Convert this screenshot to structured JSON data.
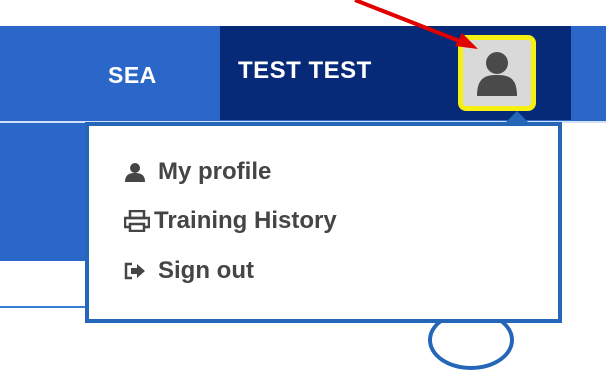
{
  "header": {
    "nav_label": "SEA",
    "user_name": "TEST TEST",
    "avatar_icon": "user-icon"
  },
  "dropdown": {
    "items": [
      {
        "label": "My profile",
        "icon": "user-icon"
      },
      {
        "label": "Training History",
        "icon": "print-icon"
      },
      {
        "label": "Sign out",
        "icon": "sign-out-icon"
      }
    ]
  },
  "colors": {
    "header_blue": "#2a67c8",
    "user_block": "#072a78",
    "highlight": "#f5ef12",
    "arrow": "#e10000"
  }
}
